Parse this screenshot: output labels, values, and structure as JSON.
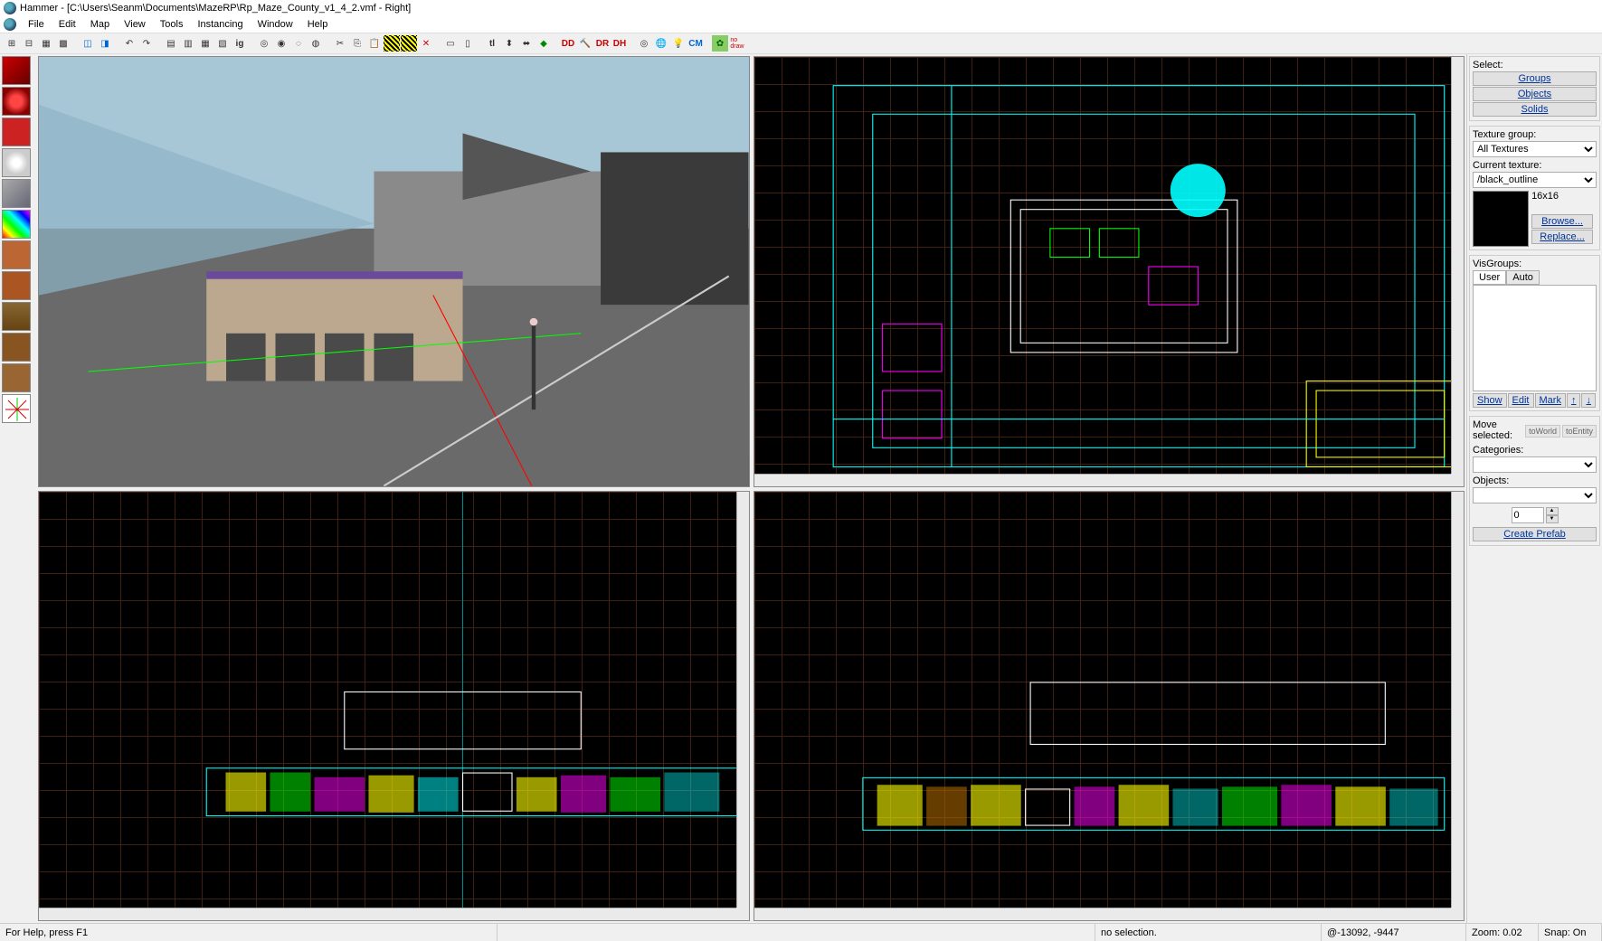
{
  "title": "Hammer - [C:\\Users\\Seanm\\Documents\\MazeRP\\Rp_Maze_County_v1_4_2.vmf - Right]",
  "menu": {
    "file": "File",
    "edit": "Edit",
    "map": "Map",
    "view": "View",
    "tools": "Tools",
    "instancing": "Instancing",
    "window": "Window",
    "help": "Help"
  },
  "right": {
    "select_label": "Select:",
    "groups": "Groups",
    "objects": "Objects",
    "solids": "Solids",
    "texgroup_label": "Texture group:",
    "texgroup_value": "All Textures",
    "curtex_label": "Current texture:",
    "curtex_value": "/black_outline",
    "tex_dims": "16x16",
    "browse": "Browse...",
    "replace": "Replace...",
    "visgroups_label": "VisGroups:",
    "tab_user": "User",
    "tab_auto": "Auto",
    "show": "Show",
    "edit": "Edit",
    "mark": "Mark",
    "up": "↑",
    "down": "↓",
    "move_selected": "Move selected:",
    "toworld": "toWorld",
    "toentity": "toEntity",
    "categories": "Categories:",
    "objects_label": "Objects:",
    "count": "0",
    "create_prefab": "Create Prefab"
  },
  "status": {
    "help": "For Help, press F1",
    "selection": "no selection.",
    "coords": "@-13092, -9447",
    "zoom": "Zoom: 0.02",
    "snap": "Snap: On"
  }
}
